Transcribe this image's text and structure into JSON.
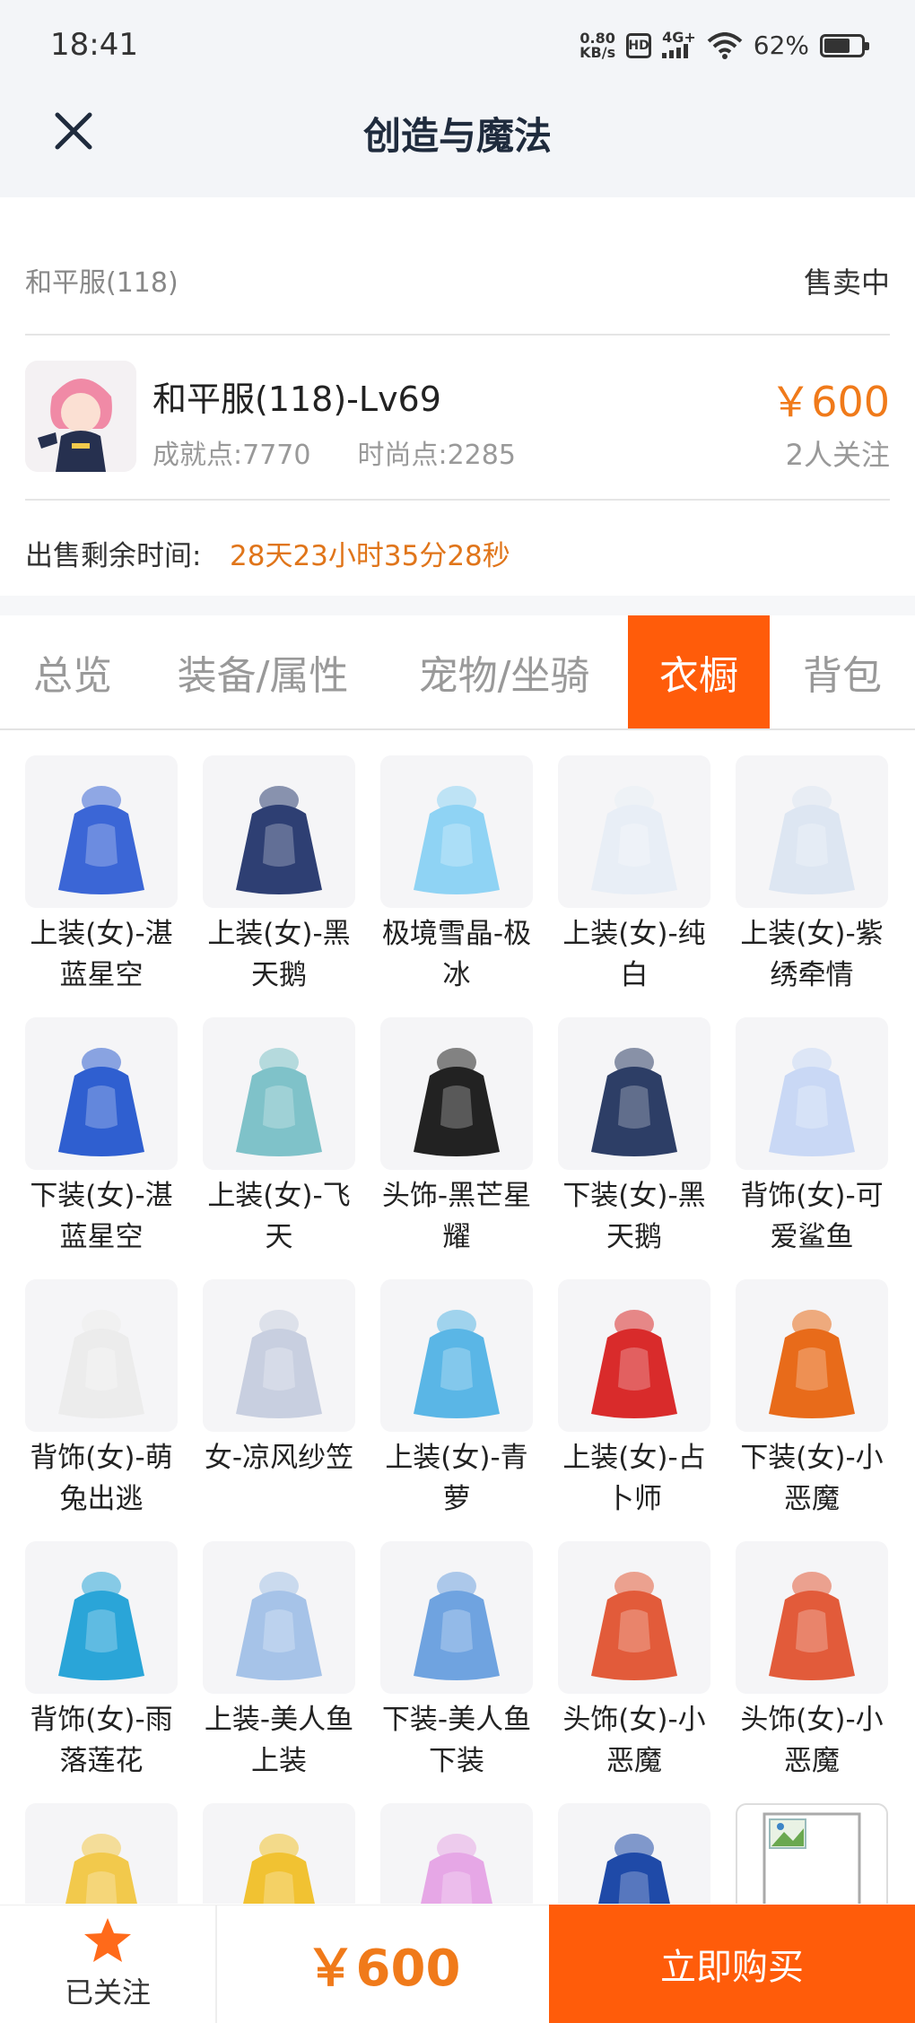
{
  "status": {
    "time": "18:41",
    "netspeed_value": "0.80",
    "netspeed_unit": "KB/s",
    "hd": "HD",
    "network": "4G+",
    "battery": "62%"
  },
  "nav": {
    "title": "创造与魔法"
  },
  "info": {
    "server": "和平服(118)",
    "sale_status": "售卖中",
    "char_name": "和平服(118)-Lv69",
    "achievement": "成就点:7770",
    "fashion": "时尚点:2285",
    "price": "￥600",
    "followers": "2人关注",
    "remain_label": "出售剩余时间:",
    "remain_value": "28天23小时35分28秒"
  },
  "tabs": [
    "总览",
    "装备/属性",
    "宠物/坐骑",
    "衣橱",
    "背包"
  ],
  "active_tab": "衣橱",
  "wardrobe": [
    {
      "label": "上装(女)-湛蓝星空",
      "icon": "blue-dress-icon"
    },
    {
      "label": "上装(女)-黑天鹅",
      "icon": "dark-dress-icon"
    },
    {
      "label": "极境雪晶-极冰",
      "icon": "ice-bow-icon"
    },
    {
      "label": "上装(女)-纯白",
      "icon": "white-dress-icon"
    },
    {
      "label": "上装(女)-紫绣牵情",
      "icon": "white-gown-icon"
    },
    {
      "label": "下装(女)-湛蓝星空",
      "icon": "blue-heels-icon"
    },
    {
      "label": "上装(女)-飞天",
      "icon": "feitian-top-icon"
    },
    {
      "label": "头饰-黑芒星耀",
      "icon": "cap-headphones-icon"
    },
    {
      "label": "下装(女)-黑天鹅",
      "icon": "dark-heels-icon"
    },
    {
      "label": "背饰(女)-可爱鲨鱼",
      "icon": "shark-icon"
    },
    {
      "label": "背饰(女)-萌兔出逃",
      "icon": "white-puff-icon"
    },
    {
      "label": "女-凉风纱笠",
      "icon": "veil-hat-icon"
    },
    {
      "label": "上装(女)-青萝",
      "icon": "cyan-dress-icon"
    },
    {
      "label": "上装(女)-占卜师",
      "icon": "red-dress-icon"
    },
    {
      "label": "下装(女)-小恶魔",
      "icon": "devil-boots-icon"
    },
    {
      "label": "背饰(女)-雨落莲花",
      "icon": "lotus-wand-icon"
    },
    {
      "label": "上装-美人鱼上装",
      "icon": "mermaid-top-icon"
    },
    {
      "label": "下装-美人鱼下装",
      "icon": "mermaid-bottom-icon"
    },
    {
      "label": "头饰(女)-小恶魔",
      "icon": "devil-horns-icon"
    },
    {
      "label": "头饰(女)-小恶魔",
      "icon": "devil-horns-icon"
    },
    {
      "label": "",
      "icon": "sunflower-hat-icon"
    },
    {
      "label": "",
      "icon": "gold-crown-icon"
    },
    {
      "label": "",
      "icon": "pink-dress-icon"
    },
    {
      "label": "",
      "icon": "blue-cape-icon"
    },
    {
      "label": "",
      "icon": "broken-image-icon"
    }
  ],
  "bottom": {
    "follow_label": "已关注",
    "price": "￥600",
    "buy_label": "立即购买"
  },
  "colors": {
    "accent": "#ff5c0a",
    "price": "#f07a1a"
  }
}
